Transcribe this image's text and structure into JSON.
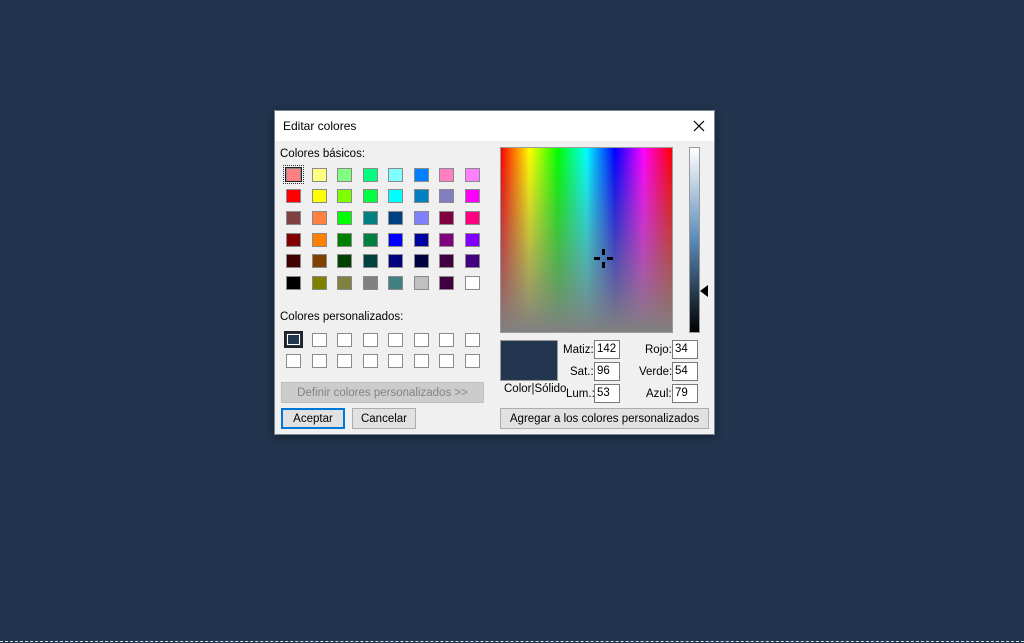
{
  "dialog": {
    "title": "Editar colores",
    "basic_colors_label": "Colores básicos:",
    "custom_colors_label": "Colores personalizados:",
    "define_custom_button": "Definir colores personalizados >>",
    "ok_button": "Aceptar",
    "cancel_button": "Cancelar",
    "add_custom_button": "Agregar a los colores personalizados",
    "color_solid_label": "Color|Sólido",
    "fields": {
      "hue": {
        "label": "Matiz:",
        "value": "142"
      },
      "sat": {
        "label": "Sat.:",
        "value": "96"
      },
      "lum": {
        "label": "Lum.:",
        "value": "53"
      },
      "red": {
        "label": "Rojo:",
        "value": "34"
      },
      "green": {
        "label": "Verde:",
        "value": "54"
      },
      "blue": {
        "label": "Azul:",
        "value": "79"
      }
    }
  },
  "colors": {
    "current": "#22364f",
    "basic": [
      "#ff8080",
      "#ffff80",
      "#80ff80",
      "#00ff80",
      "#80ffff",
      "#0080ff",
      "#ff80c0",
      "#ff80ff",
      "#ff0000",
      "#ffff00",
      "#80ff00",
      "#00ff40",
      "#00ffff",
      "#0080c0",
      "#8080c0",
      "#ff00ff",
      "#804040",
      "#ff8040",
      "#00ff00",
      "#008080",
      "#004080",
      "#8080ff",
      "#800040",
      "#ff0080",
      "#800000",
      "#ff8000",
      "#008000",
      "#008040",
      "#0000ff",
      "#0000a0",
      "#800080",
      "#8000ff",
      "#400000",
      "#804000",
      "#004000",
      "#004040",
      "#000080",
      "#000040",
      "#400040",
      "#400080",
      "#000000",
      "#808000",
      "#808040",
      "#808080",
      "#408080",
      "#c0c0c0",
      "#400040",
      "#ffffff"
    ],
    "custom": [
      "#22364f",
      "#ffffff",
      "#ffffff",
      "#ffffff",
      "#ffffff",
      "#ffffff",
      "#ffffff",
      "#ffffff",
      "#ffffff",
      "#ffffff",
      "#ffffff",
      "#ffffff",
      "#ffffff",
      "#ffffff",
      "#ffffff",
      "#ffffff"
    ]
  },
  "icons": {
    "close": "close-icon",
    "crosshair": "crosshair-icon",
    "luminosity_arrow": "arrow-left-icon"
  }
}
